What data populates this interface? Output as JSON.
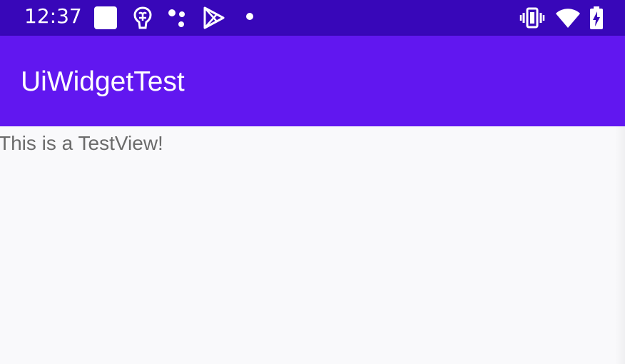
{
  "status_bar": {
    "time": "12:37",
    "icons": [
      "white-square-icon",
      "brain-icon",
      "dots-icon",
      "play-store-icon",
      "dot-icon",
      "vibrate-icon",
      "wifi-icon",
      "battery-charging-icon"
    ],
    "colors": {
      "background": "#3807b9",
      "foreground": "#ffffff"
    }
  },
  "app_bar": {
    "title": "UiWidgetTest",
    "color": "#6117f0"
  },
  "content": {
    "text": "This is a TestView!",
    "background": "#f9f9fb",
    "text_color": "#6b6b6b"
  }
}
